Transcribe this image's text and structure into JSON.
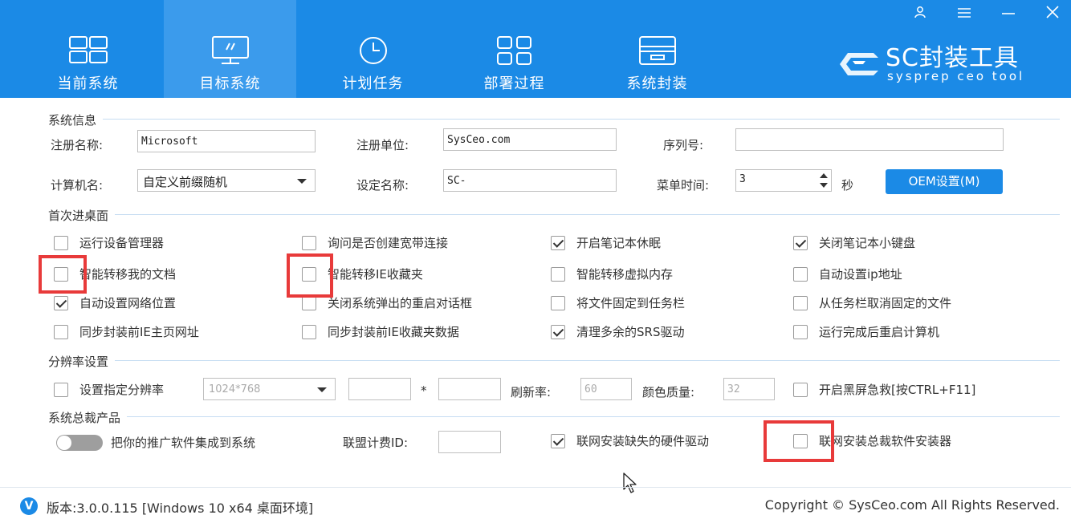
{
  "window": {
    "user_icon": "user-icon",
    "menu_icon": "hamburger-menu-icon",
    "minimize_icon": "minimize-icon",
    "close_icon": "close-icon"
  },
  "nav": {
    "tabs": [
      {
        "label": "当前系统",
        "icon": "windows-logo-icon"
      },
      {
        "label": "目标系统",
        "icon": "monitor-icon",
        "active": true
      },
      {
        "label": "计划任务",
        "icon": "clock-icon"
      },
      {
        "label": "部署过程",
        "icon": "grid-icon"
      },
      {
        "label": "系统封装",
        "icon": "package-box-icon"
      }
    ]
  },
  "brand": {
    "title": "SC封装工具",
    "subtitle": "sysprep ceo tool",
    "logo_icon": "sc-logo-icon"
  },
  "system_info": {
    "title": "系统信息",
    "reg_name_label": "注册名称:",
    "reg_name_value": "Microsoft",
    "reg_org_label": "注册单位:",
    "reg_org_value": "SysCeo.com",
    "serial_label": "序列号:",
    "serial_value": "",
    "computer_name_label": "计算机名:",
    "computer_name_value": "自定义前缀随机",
    "set_name_label": "设定名称:",
    "set_name_value": "SC-",
    "menu_time_label": "菜单时间:",
    "menu_time_value": "3",
    "menu_time_unit": "秒",
    "oem_button": "OEM设置(M)"
  },
  "first_desktop": {
    "title": "首次进桌面",
    "options": [
      {
        "label": "运行设备管理器",
        "checked": false
      },
      {
        "label": "询问是否创建宽带连接",
        "checked": false
      },
      {
        "label": "开启笔记本休眠",
        "checked": true
      },
      {
        "label": "关闭笔记本小键盘",
        "checked": true
      },
      {
        "label": "智能转移我的文档",
        "checked": false
      },
      {
        "label": "智能转移IE收藏夹",
        "checked": false
      },
      {
        "label": "智能转移虚拟内存",
        "checked": false
      },
      {
        "label": "自动设置ip地址",
        "checked": false
      },
      {
        "label": "自动设置网络位置",
        "checked": true
      },
      {
        "label": "关闭系统弹出的重启对话框",
        "checked": false
      },
      {
        "label": "将文件固定到任务栏",
        "checked": false
      },
      {
        "label": "从任务栏取消固定的文件",
        "checked": false
      },
      {
        "label": "同步封装前IE主页网址",
        "checked": false
      },
      {
        "label": "同步封装前IE收藏夹数据",
        "checked": false
      },
      {
        "label": "清理多余的SRS驱动",
        "checked": true
      },
      {
        "label": "运行完成后重启计算机",
        "checked": false
      }
    ]
  },
  "resolution": {
    "title": "分辨率设置",
    "set_label": "设置指定分辨率",
    "set_checked": false,
    "resolution_value": "1024*768",
    "width_value": "",
    "times_sign": "*",
    "height_value": "",
    "refresh_label": "刷新率:",
    "refresh_value": "60",
    "color_label": "颜色质量:",
    "color_value": "32",
    "black_screen_label": "开启黑屏急救[按CTRL+F11]",
    "black_screen_checked": false
  },
  "products": {
    "title": "系统总裁产品",
    "integrate_label": "把你的推广软件集成到系统",
    "integrate_on": false,
    "affiliate_label": "联盟计费ID:",
    "affiliate_value": "",
    "hw_driver_label": "联网安装缺失的硬件驱动",
    "hw_driver_checked": true,
    "installer_label": "联网安装总裁软件安装器",
    "installer_checked": false
  },
  "footer": {
    "version_icon": "V",
    "version": "版本:3.0.0.115 [Windows 10 x64 桌面环境]",
    "copyright": "Copyright © SysCeo.com All Rights Reserved."
  },
  "colors": {
    "primary": "#1b8ae6",
    "highlight": "#e83a3a"
  }
}
